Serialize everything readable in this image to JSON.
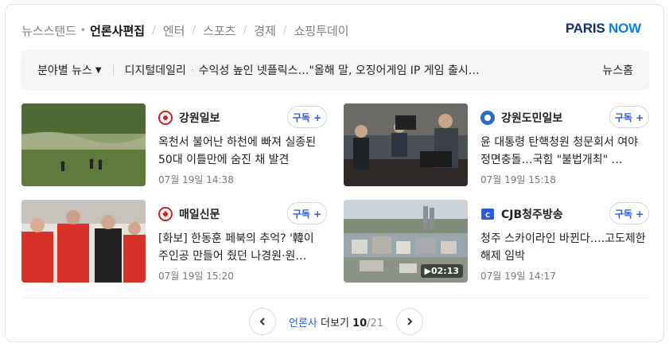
{
  "tabs": [
    {
      "label": "뉴스스탠드"
    },
    {
      "label": "언론사편집"
    },
    {
      "label": "엔터"
    },
    {
      "label": "스포츠"
    },
    {
      "label": "경제"
    },
    {
      "label": "쇼핑투데이"
    }
  ],
  "logo": {
    "part1": "PARIS ",
    "part2": "NOW",
    "colors": {
      "paris": "#15306b",
      "now": "#0a7eea"
    }
  },
  "ticker": {
    "category": "분야별 뉴스",
    "source": "디지털데일리",
    "headline": "수익성 높인 넷플릭스…\"올해 말, 오징어게임 IP 게임 출시…",
    "home": "뉴스홈"
  },
  "articles": [
    {
      "press": "강원일보",
      "subscribe": "구독 +",
      "title": "옥천서 불어난 하천에 빠져 실종된 50대 이틀만에 숨진 채 발견",
      "date": "07월 19일 14:38",
      "logo_color": "#d21f26"
    },
    {
      "press": "강원도민일보",
      "subscribe": "구독 +",
      "title": "윤 대통령 탄핵청원 청문회서 여야 정면충돌…국힘 \"불법개최\" …",
      "date": "07월 19일 15:18",
      "logo_color": "#2b6cc4"
    },
    {
      "press": "매일신문",
      "subscribe": "구독 +",
      "title": "[화보] 한동훈 페북의 추억? '韓이 주인공 만들어 줬던 나경원·원…",
      "date": "07월 19일 15:20",
      "logo_color": "#d21f26"
    },
    {
      "press": "CJB청주방송",
      "subscribe": "구독 +",
      "title": "청주 스카이라인 바뀐다….고도제한 해제 임박",
      "date": "07월 19일 14:17",
      "video_duration": "02:13",
      "logo_color": "#2b5bd7"
    }
  ],
  "pager": {
    "press_word": "언론사",
    "more": " 더보기 ",
    "current": "10",
    "total": "/21"
  },
  "accent": "#2b5bd7"
}
